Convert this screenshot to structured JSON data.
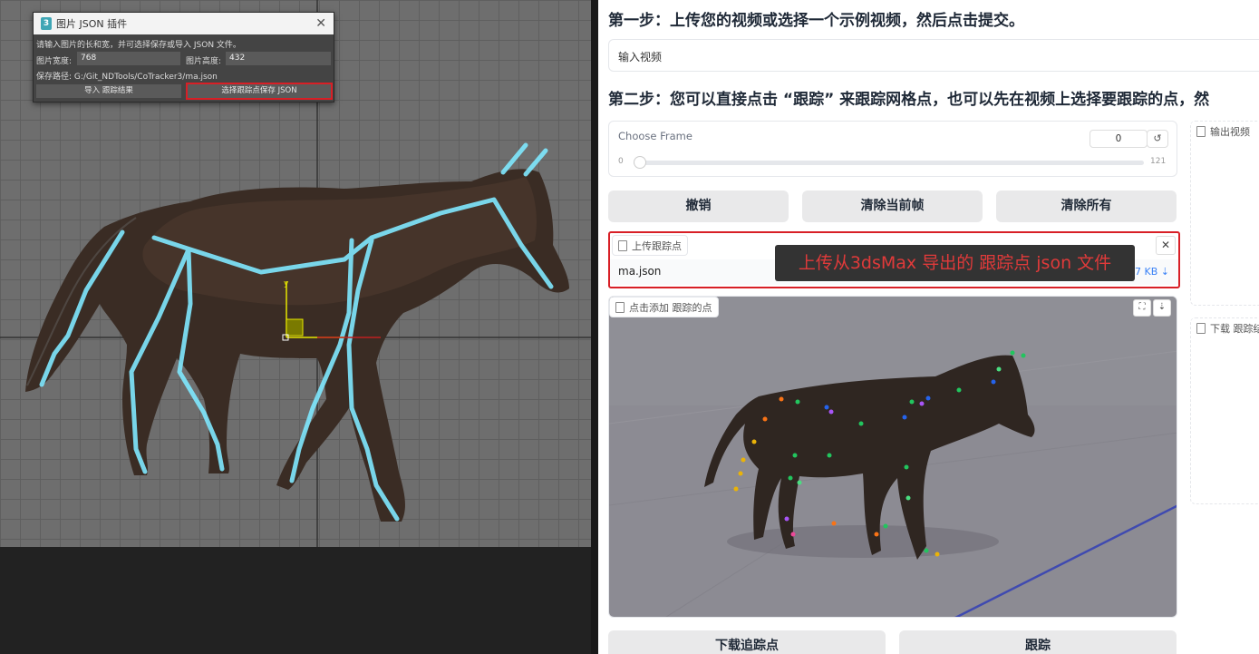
{
  "plugin": {
    "title": "图片 JSON 插件",
    "app_icon": "3dsmax-icon",
    "instruction": "请输入图片的长和宽，并可选择保存或导入 JSON 文件。",
    "width_label": "图片宽度:",
    "width_value": "768",
    "height_label": "图片高度:",
    "height_value": "432",
    "save_path": "保存路径: G:/Git_NDTools/CoTracker3/ma.json",
    "import_button": "导入 跟踪结果",
    "save_button": "选择跟踪点保存 JSON"
  },
  "page": {
    "step1_heading": "第一步：上传您的视频或选择一个示例视频，然后点击提交。",
    "input_video_label": "输入视频",
    "step2_heading": "第二步：您可以直接点击 “跟踪” 来跟踪网格点，也可以先在视频上选择要跟踪的点，然",
    "choose_frame": {
      "label": "Choose Frame",
      "value": "0",
      "min": "0",
      "max": "121",
      "current": 0
    },
    "buttons": {
      "undo": "撤销",
      "clear_current": "清除当前帧",
      "clear_all": "清除所有",
      "download": "下载追踪点",
      "track": "跟踪"
    },
    "upload": {
      "label": "上传跟踪点",
      "filename": "ma.json",
      "filesize": "3.7 KB"
    },
    "click_add_label": "点击添加 跟踪的点",
    "output_video_label": "输出视频",
    "download_result_label": "下载 跟踪结"
  },
  "annotation": "上传从3dsMax 导出的 跟踪点 json 文件",
  "colors": {
    "highlight": "#d81f26",
    "skeleton": "#7fe8ff"
  }
}
